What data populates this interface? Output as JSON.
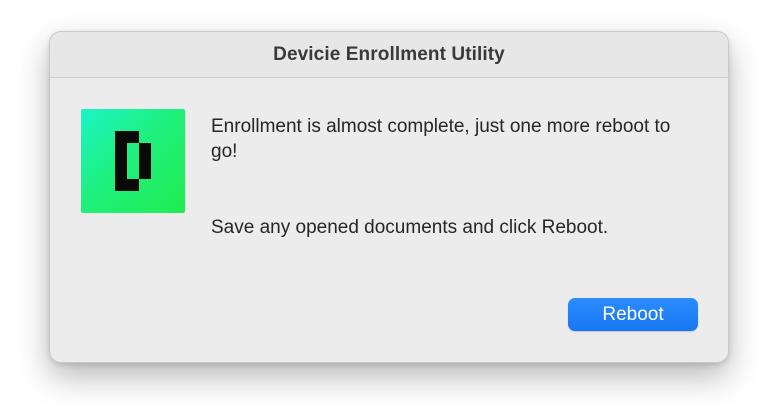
{
  "dialog": {
    "title": "Devicie Enrollment Utility",
    "message": "Enrollment is almost complete, just one more reboot to go!",
    "instruction": "Save any opened documents and click Reboot.",
    "icon": "devicie-logo-icon",
    "primary_button_label": "Reboot"
  },
  "colors": {
    "dialog_background": "#ececec",
    "button_accent": "#1f80f8",
    "icon_gradient_start": "#1cf5c8",
    "icon_gradient_end": "#20ec4f",
    "logo_glyph": "#0a0a0a"
  }
}
